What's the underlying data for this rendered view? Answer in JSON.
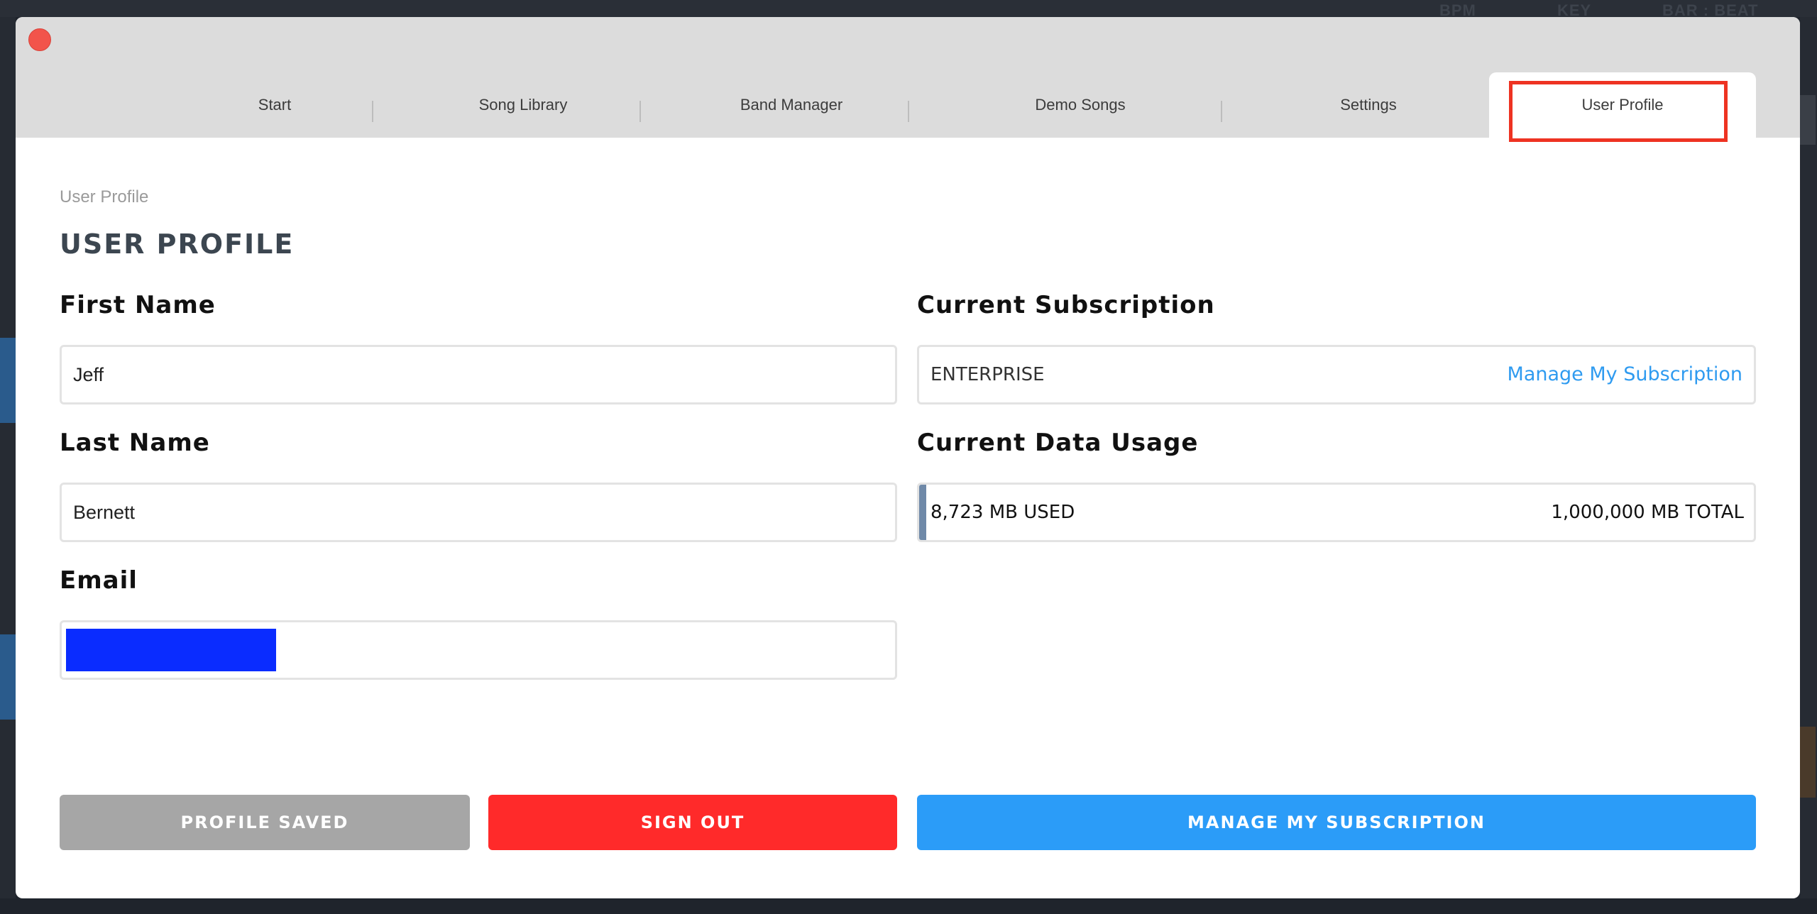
{
  "background": {
    "header_labels": [
      "BPM",
      "KEY",
      "BAR : BEAT"
    ]
  },
  "dialog": {
    "tabs": [
      {
        "label": "Start",
        "active": false
      },
      {
        "label": "Song Library",
        "active": false
      },
      {
        "label": "Band Manager",
        "active": false
      },
      {
        "label": "Demo Songs",
        "active": false
      },
      {
        "label": "Settings",
        "active": false
      },
      {
        "label": "User Profile",
        "active": true
      }
    ],
    "breadcrumb": "User Profile",
    "page_title": "USER PROFILE",
    "form": {
      "first_name_label": "First Name",
      "first_name_value": "Jeff",
      "last_name_label": "Last Name",
      "last_name_value": "Bernett",
      "email_label": "Email",
      "email_value": ""
    },
    "subscription": {
      "label": "Current Subscription",
      "value": "ENTERPRISE",
      "link": "Manage My Subscription"
    },
    "data_usage": {
      "label": "Current Data Usage",
      "used_text": "8,723 MB USED",
      "total_text": "1,000,000 MB TOTAL",
      "used_fraction": 0.0087
    },
    "buttons": {
      "profile_saved": "PROFILE SAVED",
      "sign_out": "SIGN OUT",
      "manage_subscription": "MANAGE MY SUBSCRIPTION"
    }
  },
  "colors": {
    "close": "#f2544b",
    "highlight": "#ee3322",
    "link": "#2f9bf0",
    "profile_saved_bg": "#a6a6a6",
    "sign_out_bg": "#ff2a2a",
    "manage_bg": "#2b9cf8",
    "usage_bar": "#6f89a8",
    "redaction": "#0a2cff"
  }
}
